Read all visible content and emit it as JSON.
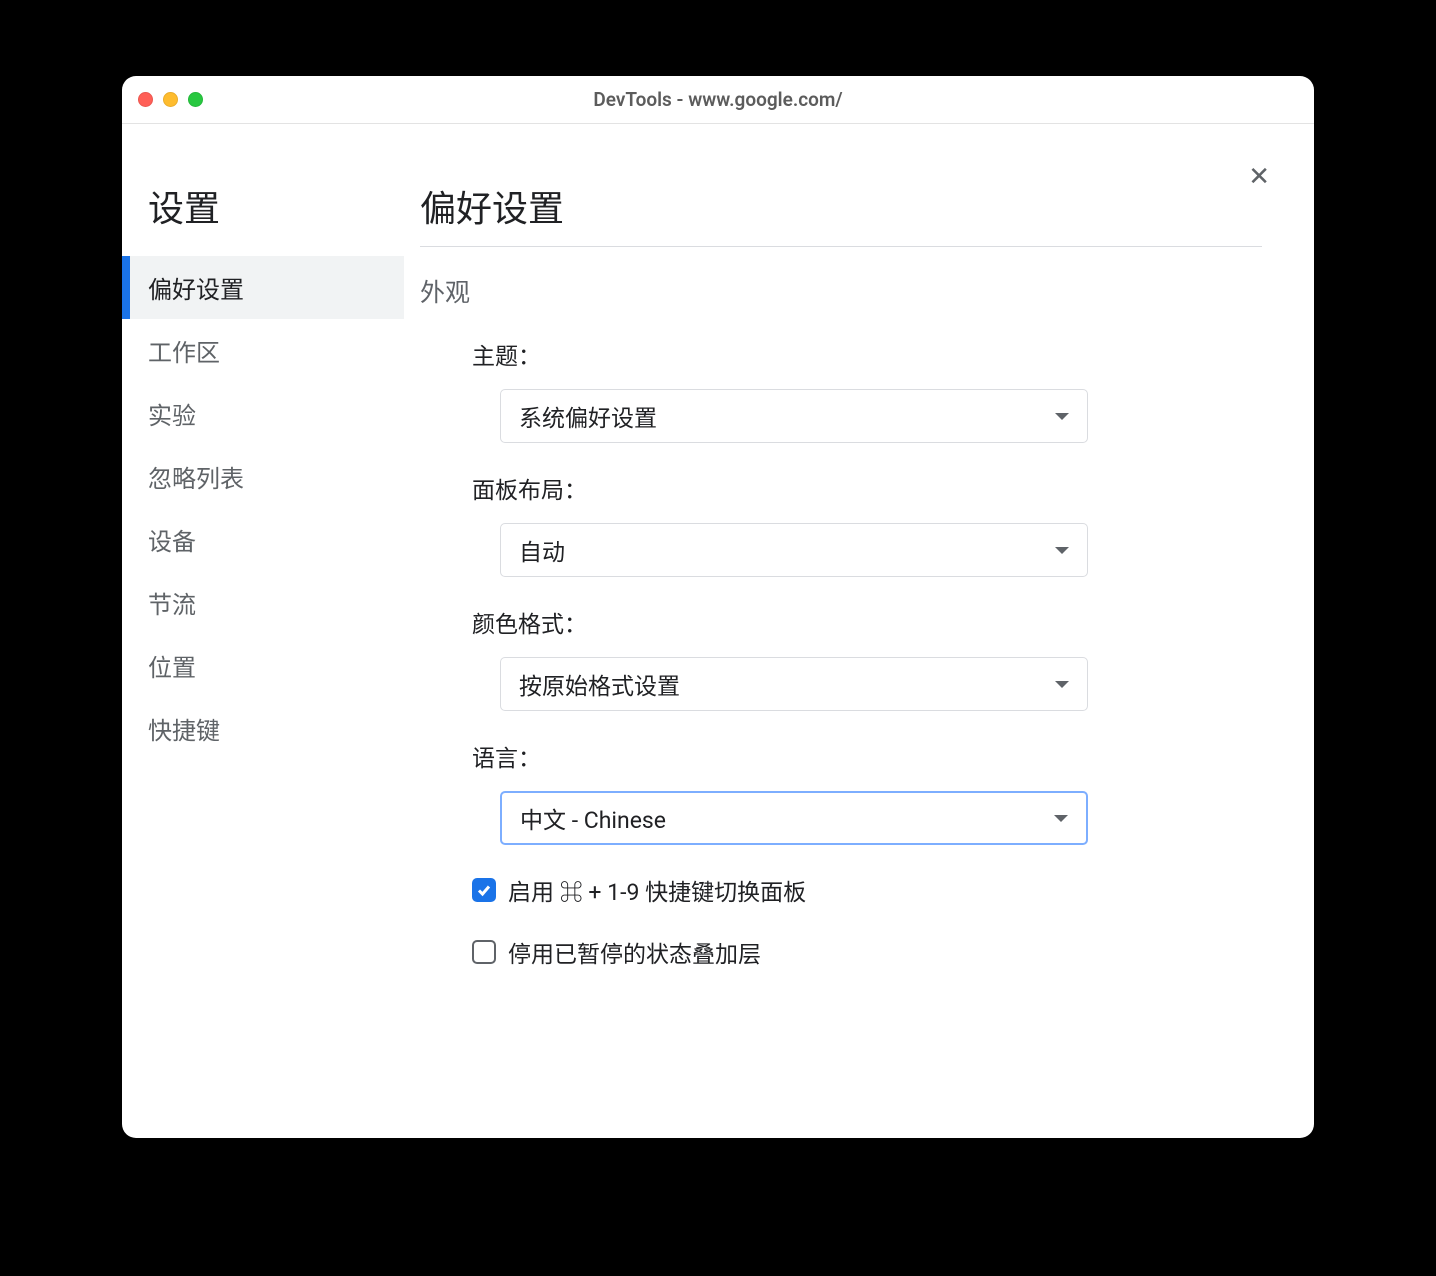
{
  "window": {
    "title": "DevTools - www.google.com/"
  },
  "sidebar": {
    "title": "设置",
    "items": [
      {
        "label": "偏好设置",
        "key": "preferences",
        "active": true
      },
      {
        "label": "工作区",
        "key": "workspace",
        "active": false
      },
      {
        "label": "实验",
        "key": "experiments",
        "active": false
      },
      {
        "label": "忽略列表",
        "key": "ignore-list",
        "active": false
      },
      {
        "label": "设备",
        "key": "devices",
        "active": false
      },
      {
        "label": "节流",
        "key": "throttling",
        "active": false
      },
      {
        "label": "位置",
        "key": "locations",
        "active": false
      },
      {
        "label": "快捷键",
        "key": "shortcuts",
        "active": false
      }
    ]
  },
  "main": {
    "title": "偏好设置",
    "section": "外观",
    "fields": {
      "theme": {
        "label": "主题：",
        "value": "系统偏好设置"
      },
      "panel_layout": {
        "label": "面板布局：",
        "value": "自动"
      },
      "color_format": {
        "label": "颜色格式：",
        "value": "按原始格式设置"
      },
      "language": {
        "label": "语言：",
        "value": "中文 - Chinese",
        "focused": true
      }
    },
    "checkboxes": {
      "shortcut_switch": {
        "label": "启用 ⌘ + 1-9 快捷键切换面板",
        "checked": true
      },
      "disable_overlay": {
        "label": "停用已暂停的状态叠加层",
        "checked": false
      }
    }
  }
}
